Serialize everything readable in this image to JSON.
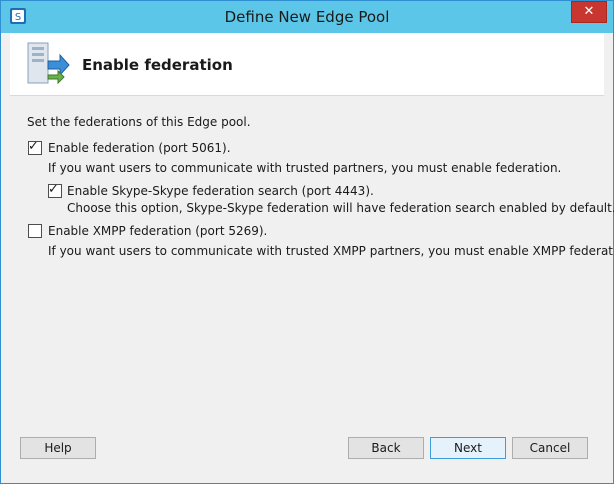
{
  "window": {
    "title": "Define New Edge Pool",
    "close_glyph": "✕",
    "app_icon": "lync-server-icon",
    "title_bar_color": "#5bc6e8",
    "close_color": "#c7372f"
  },
  "header": {
    "title": "Enable federation",
    "icon": "topology-arrows-icon"
  },
  "content": {
    "intro": "Set the federations of this Edge pool.",
    "federation": {
      "label": "Enable federation (port 5061).",
      "checked": true,
      "description": "If you want users to communicate with trusted partners, you must enable federation."
    },
    "skype": {
      "label": "Enable Skype-Skype federation search (port 4443).",
      "checked": true,
      "description": "Choose this option, Skype-Skype federation will have federation search enabled by default."
    },
    "xmpp": {
      "label": "Enable XMPP federation (port 5269).",
      "checked": false,
      "description": "If you want users to communicate with trusted XMPP partners, you must enable XMPP federation."
    }
  },
  "buttons": {
    "help": "Help",
    "back": "Back",
    "next": "Next",
    "cancel": "Cancel"
  },
  "check_glyph": "✓"
}
